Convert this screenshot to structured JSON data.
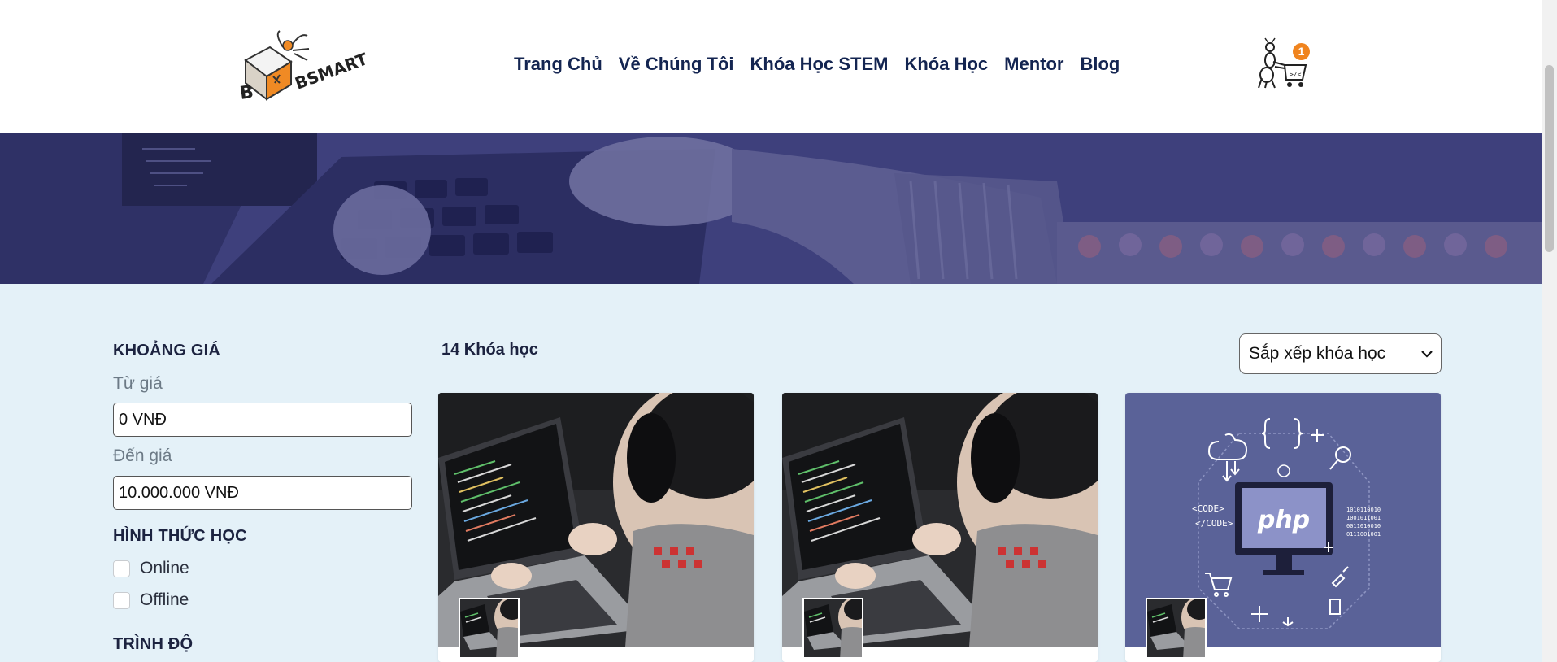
{
  "brand": {
    "logo_text": "BSMART"
  },
  "nav": {
    "items": [
      {
        "label": "Trang Chủ"
      },
      {
        "label": "Về Chúng Tôi"
      },
      {
        "label": "Khóa Học STEM"
      },
      {
        "label": "Khóa Học"
      },
      {
        "label": "Mentor"
      },
      {
        "label": "Blog"
      }
    ]
  },
  "cart": {
    "count": "1",
    "icon": "ant-cart-icon"
  },
  "filter": {
    "price_heading": "KHOẢNG GIÁ",
    "from_label": "Từ giá",
    "from_value": "0 VNĐ",
    "to_label": "Đến giá",
    "to_value": "10.000.000 VNĐ",
    "format_heading": "HÌNH THỨC HỌC",
    "formats": [
      {
        "label": "Online"
      },
      {
        "label": "Offline"
      }
    ],
    "level_heading": "TRÌNH ĐỘ"
  },
  "courses": {
    "count_label": "14 Khóa học",
    "sort_label": "Sắp xếp khóa học",
    "cards": [
      {
        "image": "laptop-coding-photo"
      },
      {
        "image": "laptop-coding-photo"
      },
      {
        "image": "php-illustration",
        "badge_text": "php",
        "code_text": "<CODE>\n</CODE>",
        "binary_text": "1010110010"
      }
    ]
  },
  "colors": {
    "nav_text": "#142551",
    "page_bg": "#e4f1f8",
    "badge": "#f0841e",
    "php_card_bg": "#5a6298"
  }
}
